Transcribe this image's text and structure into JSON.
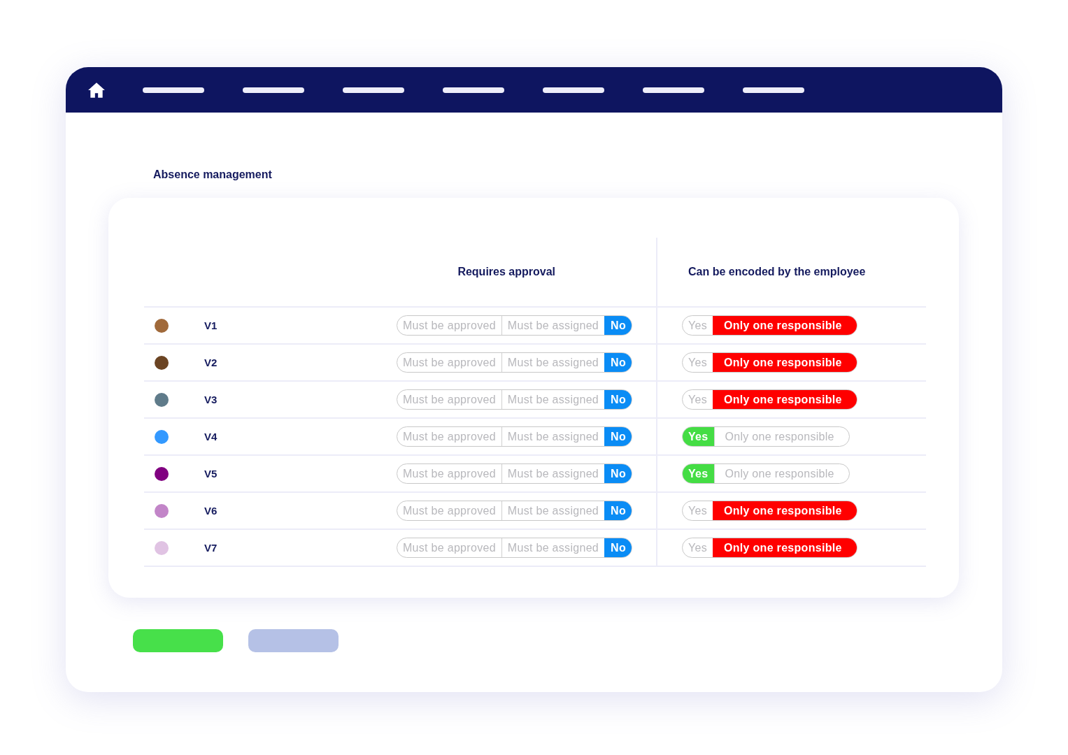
{
  "page": {
    "title": "Absence management"
  },
  "table": {
    "columns": [
      "Requires approval",
      "Can be encoded by the employee"
    ],
    "rows": [
      {
        "name": "V1",
        "color": "#a0693a",
        "approval": [
          {
            "label": "Must be approved",
            "selected": false
          },
          {
            "label": "Must be assigned",
            "selected": false
          },
          {
            "label": "No",
            "selected": true
          }
        ],
        "encoding": [
          {
            "label": "Yes",
            "selected": false
          },
          {
            "label": "Only one responsible",
            "selected": true
          }
        ]
      },
      {
        "name": "V2",
        "color": "#6b4423",
        "approval": [
          {
            "label": "Must be approved",
            "selected": false
          },
          {
            "label": "Must be assigned",
            "selected": false
          },
          {
            "label": "No",
            "selected": true
          }
        ],
        "encoding": [
          {
            "label": "Yes",
            "selected": false
          },
          {
            "label": "Only one responsible",
            "selected": true
          }
        ]
      },
      {
        "name": "V3",
        "color": "#5f7b8a",
        "approval": [
          {
            "label": "Must be approved",
            "selected": false
          },
          {
            "label": "Must be assigned",
            "selected": false
          },
          {
            "label": "No",
            "selected": true
          }
        ],
        "encoding": [
          {
            "label": "Yes",
            "selected": false
          },
          {
            "label": "Only one responsible",
            "selected": true
          }
        ]
      },
      {
        "name": "V4",
        "color": "#3399ff",
        "approval": [
          {
            "label": "Must be approved",
            "selected": false
          },
          {
            "label": "Must be assigned",
            "selected": false
          },
          {
            "label": "No",
            "selected": true
          }
        ],
        "encoding": [
          {
            "label": "Yes",
            "selected": true
          },
          {
            "label": "Only one responsible",
            "selected": false
          }
        ]
      },
      {
        "name": "V5",
        "color": "#800080",
        "approval": [
          {
            "label": "Must be approved",
            "selected": false
          },
          {
            "label": "Must be assigned",
            "selected": false
          },
          {
            "label": "No",
            "selected": true
          }
        ],
        "encoding": [
          {
            "label": "Yes",
            "selected": true
          },
          {
            "label": "Only one responsible",
            "selected": false
          }
        ]
      },
      {
        "name": "V6",
        "color": "#c285c8",
        "approval": [
          {
            "label": "Must be approved",
            "selected": false
          },
          {
            "label": "Must be assigned",
            "selected": false
          },
          {
            "label": "No",
            "selected": true
          }
        ],
        "encoding": [
          {
            "label": "Yes",
            "selected": false
          },
          {
            "label": "Only one responsible",
            "selected": true
          }
        ]
      },
      {
        "name": "V7",
        "color": "#e0c3e3",
        "approval": [
          {
            "label": "Must be approved",
            "selected": false
          },
          {
            "label": "Must be assigned",
            "selected": false
          },
          {
            "label": "No",
            "selected": true
          }
        ],
        "encoding": [
          {
            "label": "Yes",
            "selected": false
          },
          {
            "label": "Only one responsible",
            "selected": true
          }
        ]
      }
    ]
  },
  "actions": [
    {
      "kind": "primary"
    },
    {
      "kind": "secondary"
    }
  ]
}
